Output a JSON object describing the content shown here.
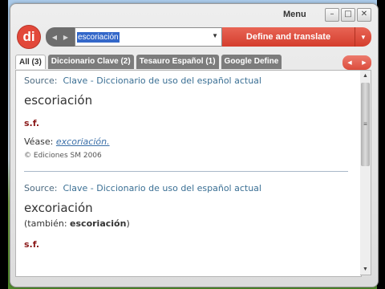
{
  "window": {
    "menu_label": "Menu",
    "buttons": {
      "minimize": "–",
      "restore": "□",
      "close": "✕"
    }
  },
  "logo": {
    "text": "di"
  },
  "toolbar": {
    "back": "◀",
    "forward": "▶",
    "search_value": "escoriación",
    "dropdown": "▼",
    "define_label": "Define and translate",
    "define_dropdown": "▼"
  },
  "tabs": [
    {
      "label": "All (3)",
      "active": true
    },
    {
      "label": "Diccionario Clave (2)",
      "active": false
    },
    {
      "label": "Tesauro Español (1)",
      "active": false
    },
    {
      "label": "Google Define",
      "active": false
    }
  ],
  "tab_nav": {
    "prev": "◀",
    "next": "▶"
  },
  "entries": [
    {
      "source_prefix": "Source:",
      "source_name": "Clave - Diccionario de uso del español actual",
      "headword": "escoriación",
      "pos": "s.f.",
      "see_label": "Véase:",
      "see_link": "excoriación.",
      "copyright": "© Ediciones SM 2006"
    },
    {
      "source_prefix": "Source:",
      "source_name": "Clave - Diccionario de uso del español actual",
      "headword": "excoriación",
      "also_prefix": "(también:",
      "also_word": "escoriación",
      "also_suffix": ")",
      "pos": "s.f."
    }
  ],
  "scrollbar": {
    "up": "▲",
    "down": "▼",
    "grip": "≡"
  },
  "colors": {
    "accent": "#d43d2d",
    "tab_bg": "#7c7c7c",
    "pos_color": "#8b1a1a",
    "link": "#3a6fa8"
  }
}
